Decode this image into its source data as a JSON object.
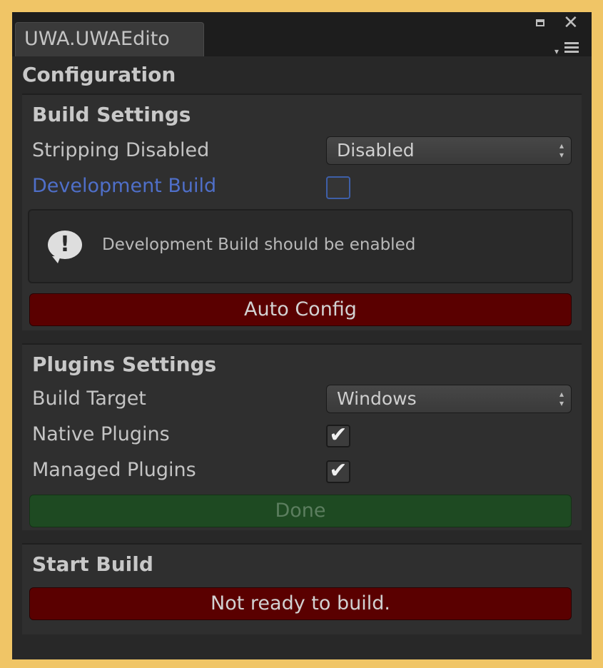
{
  "tab": {
    "title": "UWA.UWAEdito"
  },
  "window_controls": {
    "maximize_icon": "maximize-icon",
    "close_icon": "close-icon",
    "close_glyph": "✕",
    "menu_icon": "context-menu-icon"
  },
  "page": {
    "title": "Configuration"
  },
  "build_settings": {
    "heading": "Build Settings",
    "stripping_label": "Stripping Disabled",
    "stripping_value": "Disabled",
    "development_label": "Development Build",
    "development_checked": false,
    "help_message": "Development Build should be enabled",
    "help_icon": "info-icon",
    "help_glyph": "!",
    "auto_config_label": "Auto Config"
  },
  "plugins_settings": {
    "heading": "Plugins Settings",
    "build_target_label": "Build Target",
    "build_target_value": "Windows",
    "native_label": "Native Plugins",
    "native_checked": true,
    "managed_label": "Managed Plugins",
    "managed_checked": true,
    "check_glyph": "✔",
    "done_label": "Done"
  },
  "start_build": {
    "heading": "Start Build",
    "status_label": "Not ready to build."
  },
  "colors": {
    "background": "#f0c566",
    "panel": "#282828",
    "error_button": "#5a0000",
    "done_button": "#1e4a22",
    "modified_label": "#4f6fc9"
  }
}
